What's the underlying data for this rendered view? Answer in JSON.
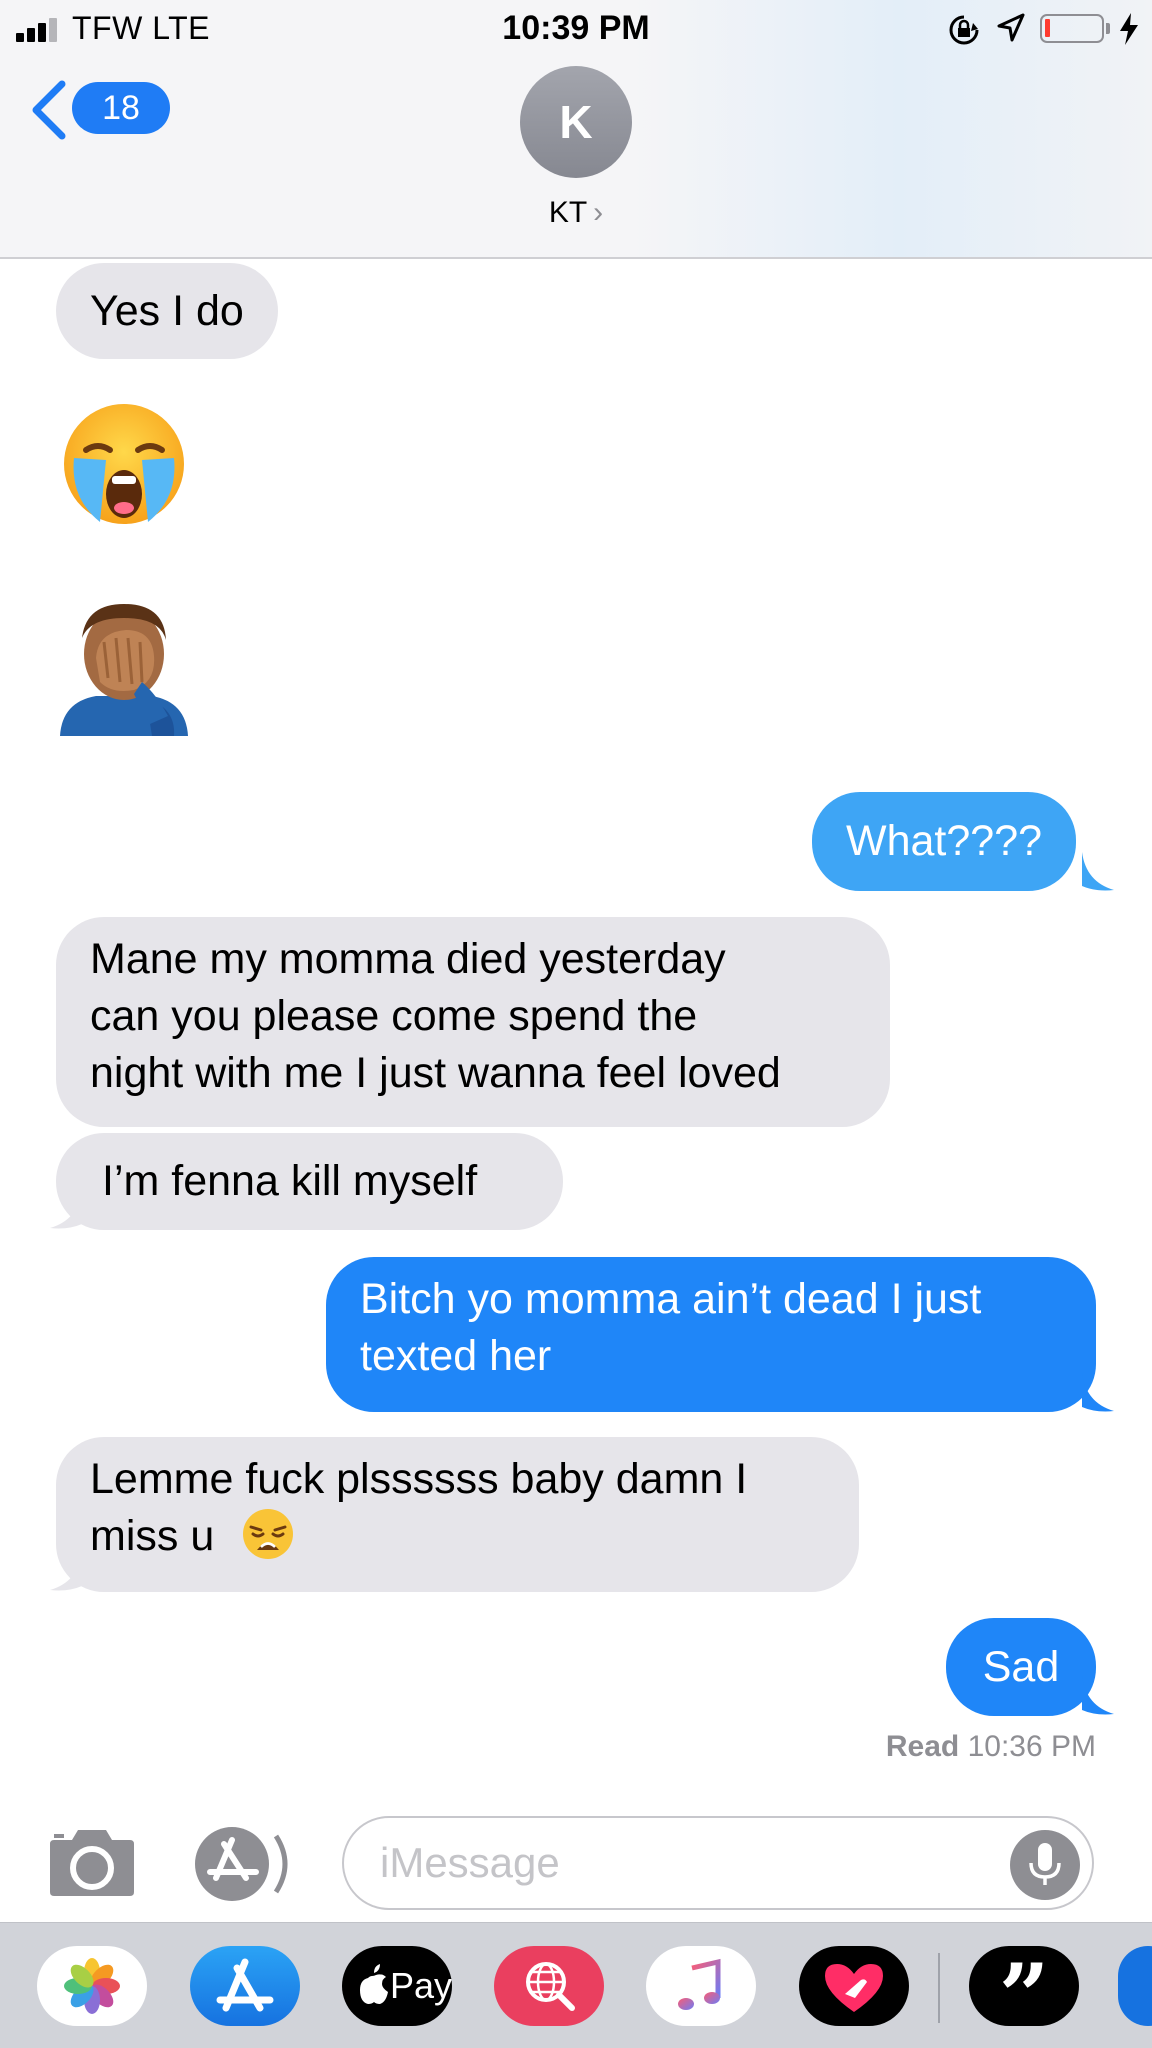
{
  "status_bar": {
    "carrier": "TFW  LTE",
    "time": "10:39 PM",
    "signal_bars": 3,
    "battery_level": 0.05
  },
  "header": {
    "back_count": "18",
    "avatar_initial": "K",
    "contact_name": "KT",
    "chevron": "›"
  },
  "messages": [
    {
      "id": "m1",
      "sender": "them",
      "text": "Yes I do"
    },
    {
      "id": "m2",
      "sender": "them",
      "emoji": "loudly-crying-face"
    },
    {
      "id": "m3",
      "sender": "them",
      "emoji": "man-facepalming"
    },
    {
      "id": "m4",
      "sender": "me",
      "text": "What????"
    },
    {
      "id": "m5",
      "sender": "them",
      "lines": [
        "Mane my momma died yesterday",
        "can you please come spend the",
        "night with me I just wanna feel loved"
      ]
    },
    {
      "id": "m6",
      "sender": "them",
      "text": "I’m fenna kill myself"
    },
    {
      "id": "m7",
      "sender": "me",
      "lines": [
        "Bitch yo momma ain’t dead I just",
        "texted her"
      ]
    },
    {
      "id": "m8",
      "sender": "them",
      "lines": [
        "Lemme fuck plssssss baby damn I",
        "miss u"
      ],
      "trailing_emoji": "weary-face"
    },
    {
      "id": "m9",
      "sender": "me",
      "text": "Sad"
    }
  ],
  "receipt": {
    "label": "Read",
    "time": "10:36 PM"
  },
  "composer": {
    "placeholder": "iMessage"
  },
  "app_drawer": [
    {
      "name": "photos-app",
      "icon": "photos-flower-icon"
    },
    {
      "name": "app-store-app",
      "icon": "app-store-icon"
    },
    {
      "name": "apple-pay-app",
      "label": "Pay",
      "icon": "apple-logo-icon"
    },
    {
      "name": "search-images-app",
      "icon": "globe-search-icon"
    },
    {
      "name": "music-app",
      "icon": "music-note-icon"
    },
    {
      "name": "digital-touch-app",
      "icon": "heart-touch-icon"
    },
    {
      "name": "quotes-app",
      "label": "”",
      "icon": "quote-icon"
    }
  ],
  "colors": {
    "outgoing_bubble": "#1f86f8",
    "incoming_bubble": "#e6e5ea",
    "accent": "#1f7cf5",
    "meta_text": "#8e8e93"
  }
}
